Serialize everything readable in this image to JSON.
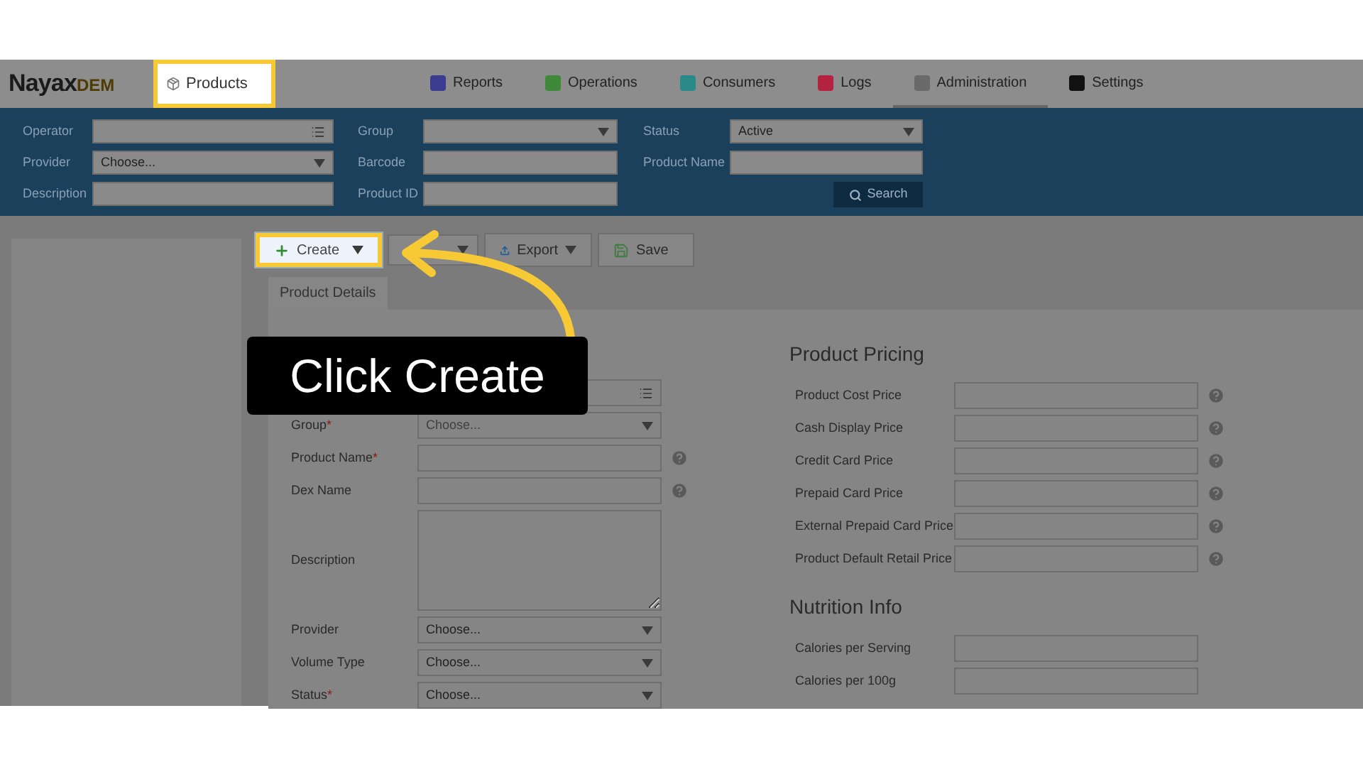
{
  "logo": {
    "name": "Nayax",
    "suffix": "DEM"
  },
  "current_page": {
    "label": "Products",
    "highlighted": true
  },
  "nav": [
    {
      "label": "Reports",
      "color": "#3b3b8f",
      "selected": false
    },
    {
      "label": "Operations",
      "color": "#3f8a3a",
      "selected": false
    },
    {
      "label": "Consumers",
      "color": "#2a8a8a",
      "selected": false
    },
    {
      "label": "Logs",
      "color": "#b3223f",
      "selected": false
    },
    {
      "label": "Administration",
      "color": "#6a6a6a",
      "selected": true
    },
    {
      "label": "Settings",
      "color": "#111111",
      "selected": false
    }
  ],
  "filter_columns": [
    {
      "fields": [
        {
          "label": "Operator",
          "kind": "list"
        },
        {
          "label": "Provider",
          "kind": "select",
          "value": "Choose..."
        },
        {
          "label": "Description",
          "kind": "text"
        }
      ]
    },
    {
      "fields": [
        {
          "label": "Group",
          "kind": "select"
        },
        {
          "label": "Barcode",
          "kind": "text"
        },
        {
          "label": "Product ID",
          "kind": "text"
        }
      ]
    },
    {
      "fields": [
        {
          "label": "Status",
          "kind": "select",
          "value": "Active"
        },
        {
          "label": "Product Name",
          "kind": "text"
        }
      ]
    }
  ],
  "search_button": "Search",
  "toolbar": [
    {
      "kind": "create",
      "label": "Create",
      "highlighted": true
    },
    {
      "kind": "menu"
    },
    {
      "kind": "export",
      "label": "Export",
      "highlighted": false
    },
    {
      "kind": "save",
      "label": "Save",
      "highlighted": false
    }
  ],
  "tabs": [
    {
      "label": "Product Details",
      "selected": true
    }
  ],
  "details_fields": [
    {
      "kind": "list",
      "help": false
    },
    {
      "label": "Group",
      "mark": "*",
      "kind": "select",
      "placeholder": "Choose...",
      "help": false
    },
    {
      "label": "Product Name",
      "mark": "*",
      "kind": "text",
      "help": true
    },
    {
      "label": "Dex Name",
      "kind": "text",
      "help": true
    },
    {
      "label": "Description",
      "kind": "textarea",
      "help": false
    },
    {
      "label": "Provider",
      "kind": "select",
      "value": "Choose...",
      "help": false
    },
    {
      "label": "Volume Type",
      "kind": "select",
      "value": "Choose...",
      "help": false
    },
    {
      "label": "Status",
      "mark": "*",
      "kind": "select",
      "value": "Choose...",
      "help": false
    }
  ],
  "sections": [
    {
      "title": "Product Pricing",
      "fields": [
        {
          "label": "Product Cost Price",
          "help": true
        },
        {
          "label": "Cash Display Price",
          "help": true
        },
        {
          "label": "Credit Card Price",
          "help": true
        },
        {
          "label": "Prepaid Card Price",
          "help": true
        },
        {
          "label": "External Prepaid Card Price",
          "help": true
        },
        {
          "label": "Product Default Retail Price",
          "help": true
        }
      ]
    },
    {
      "title": "Nutrition Info",
      "fields": [
        {
          "label": "Calories per Serving",
          "help": false
        },
        {
          "label": "Calories per 100g",
          "help": false
        }
      ]
    }
  ],
  "callout": {
    "text": "Click Create"
  }
}
